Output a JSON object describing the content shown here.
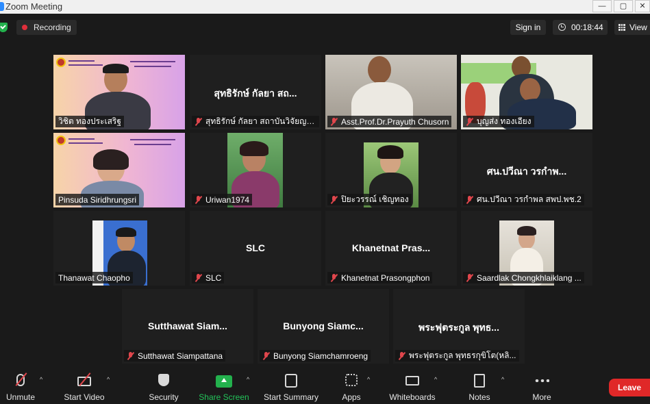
{
  "window": {
    "title": "Zoom Meeting",
    "min": "—",
    "max": "▢",
    "close": "✕"
  },
  "topbar": {
    "recording_label": "Recording",
    "signin_label": "Sign in",
    "timer": "00:18:44",
    "view_label": "View"
  },
  "participants": [
    {
      "name": "วิชิต ทองประเสริฐ",
      "center": "",
      "muted": false,
      "active": true
    },
    {
      "name": "สุทธิรักษ์ กัลยา สถาบันวิจัยญา...",
      "center": "สุทธิรักษ์ กัลยา สถ...",
      "muted": true
    },
    {
      "name": "Asst.Prof.Dr.Prayuth Chusorn",
      "center": "",
      "muted": true
    },
    {
      "name": "บุญส่ง ทองเอียง",
      "center": "",
      "muted": true
    },
    {
      "name": "Pinsuda Siridhrungsri",
      "center": "",
      "muted": false
    },
    {
      "name": "Uriwan1974",
      "center": "",
      "muted": true
    },
    {
      "name": "ปิยะวรรณ์ เชิญทอง",
      "center": "",
      "muted": true
    },
    {
      "name": "ศน.ปวีณา วรกำพล สพป.พช.2",
      "center": "ศน.ปวีณา วรกำพ...",
      "muted": true
    },
    {
      "name": "Thanawat Chaopho",
      "center": "",
      "muted": false
    },
    {
      "name": "SLC",
      "center": "SLC",
      "muted": true
    },
    {
      "name": "Khanetnat Prasongphon",
      "center": "Khanetnat Pras...",
      "muted": true
    },
    {
      "name": "Saardlak Chongkhlaiklang ...",
      "center": "",
      "muted": true
    },
    {
      "name": "Sutthawat Siampattana",
      "center": "Sutthawat Siam...",
      "muted": true
    },
    {
      "name": "Bunyong Siamchamroeng",
      "center": "Bunyong Siamc...",
      "muted": true
    },
    {
      "name": "พระฟุตระกูล พุทธรกุขิโต(หลิ...",
      "center": "พระฟุตระกูล พุทธ...",
      "muted": true
    }
  ],
  "toolbar": {
    "unmute": "Unmute",
    "start_video": "Start Video",
    "security": "Security",
    "share_screen": "Share Screen",
    "start_summary": "Start Summary",
    "apps": "Apps",
    "whiteboards": "Whiteboards",
    "notes": "Notes",
    "more": "More",
    "leave": "Leave"
  },
  "colors": {
    "active_speaker": "#f0f25a",
    "share_green": "#23b14d",
    "leave_red": "#e02828",
    "muted_red": "#e0464c"
  }
}
